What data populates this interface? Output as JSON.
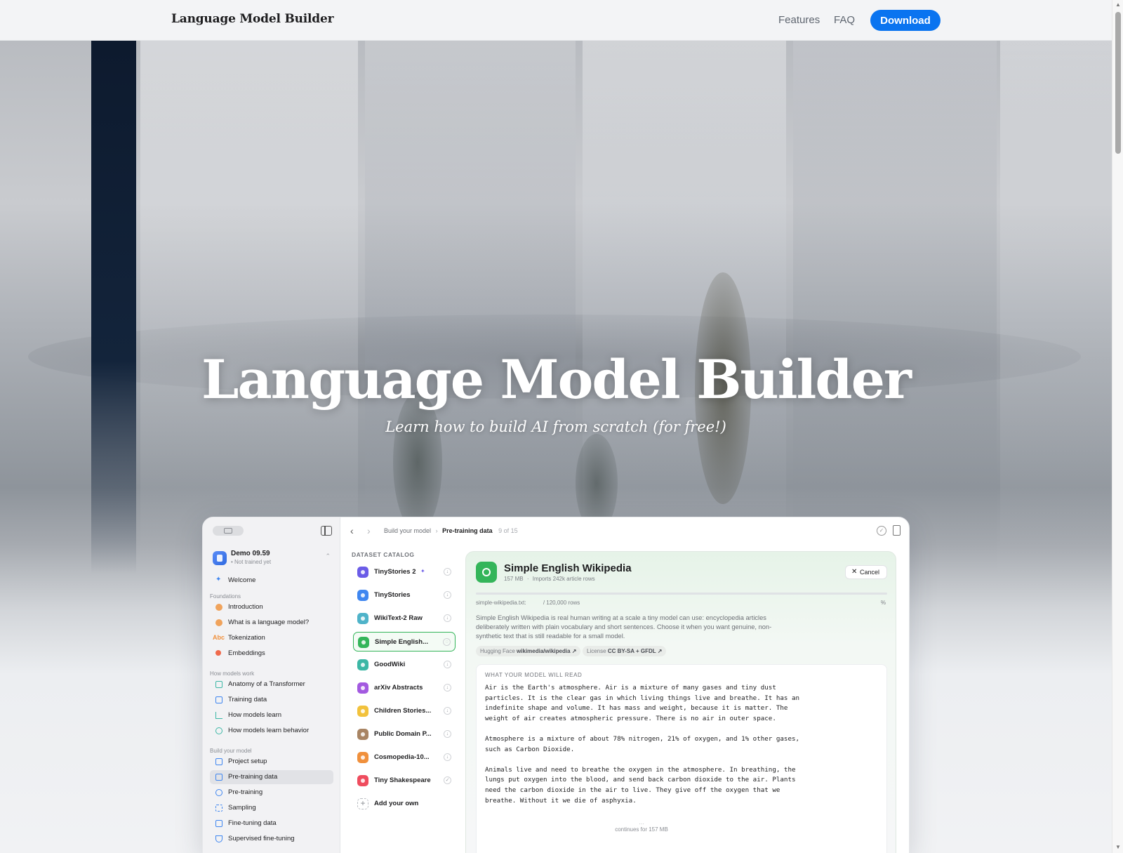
{
  "site": {
    "brand": "Language Model Builder",
    "nav": {
      "features": "Features",
      "faq": "FAQ",
      "download": "Download"
    }
  },
  "hero": {
    "title": "Language Model Builder",
    "subtitle": "Learn how to build AI from scratch (for free!)"
  },
  "app": {
    "project": {
      "name": "Demo 09.59",
      "status": "• Not trained yet"
    },
    "sidebar": {
      "top_item": "Welcome",
      "sections": [
        {
          "heading": "Foundations",
          "items": [
            "Introduction",
            "What is a language model?",
            "Tokenization",
            "Embeddings"
          ]
        },
        {
          "heading": "How models work",
          "items": [
            "Anatomy of a Transformer",
            "Training data",
            "How models learn",
            "How models learn behavior"
          ]
        },
        {
          "heading": "Build your model",
          "items": [
            "Project setup",
            "Pre-training data",
            "Pre-training",
            "Sampling",
            "Fine-tuning data",
            "Supervised fine-tuning"
          ]
        }
      ],
      "active_item": "Pre-training data",
      "abc_icon": "Abc"
    },
    "toolbar": {
      "breadcrumb_parent": "Build your model",
      "breadcrumb_sep": "›",
      "breadcrumb_current": "Pre-training data",
      "step": "9 of 15"
    },
    "catalog": {
      "heading": "DATASET CATALOG",
      "items": [
        {
          "label": "TinyStories 2",
          "color": "#6b5ce7",
          "badge": "✦",
          "icon": "moon-icon"
        },
        {
          "label": "TinyStories",
          "color": "#3f86f0",
          "icon": "book-icon"
        },
        {
          "label": "WikiText-2 Raw",
          "color": "#4fb3c9",
          "icon": "globe-icon"
        },
        {
          "label": "Simple English...",
          "color": "#34b55a",
          "icon": "globe-icon",
          "selected": true
        },
        {
          "label": "GoodWiki",
          "color": "#3cb7a5",
          "icon": "globe-icon"
        },
        {
          "label": "arXiv Abstracts",
          "color": "#a35ae0",
          "icon": "atom-icon"
        },
        {
          "label": "Children Stories...",
          "color": "#f2c23c",
          "icon": "storybook-icon"
        },
        {
          "label": "Public Domain P...",
          "color": "#a88463",
          "icon": "quote-icon"
        },
        {
          "label": "Cosmopedia-10...",
          "color": "#f0903c",
          "icon": "cap-icon"
        },
        {
          "label": "Tiny Shakespeare",
          "color": "#ef4c5e",
          "icon": "masks-icon",
          "checked": true
        }
      ],
      "add_label": "Add your own"
    },
    "detail": {
      "title": "Simple English Wikipedia",
      "size": "157 MB",
      "meta_sep": "·",
      "imports": "Imports 242k article rows",
      "cancel": "Cancel",
      "progress_pct": 0.0,
      "file": "simple-wikipedia.txt:",
      "rows": "/ 120,000 rows",
      "pct_label": "%",
      "description": "Simple English Wikipedia is real human writing at a scale a tiny model can use: encyclopedia articles deliberately written with plain vocabulary and short sentences. Choose it when you want genuine, non-synthetic text that is still readable for a small model.",
      "tags": [
        {
          "key": "Hugging Face",
          "value": "wikimedia/wikipedia ↗"
        },
        {
          "key": "License",
          "value": "CC BY-SA + GFDL ↗"
        }
      ],
      "preview_heading": "WHAT YOUR MODEL WILL READ",
      "preview_text": "Air is the Earth's atmosphere. Air is a mixture of many gases and tiny dust\nparticles. It is the clear gas in which living things live and breathe. It has an\nindefinite shape and volume. It has mass and weight, because it is matter. The\nweight of air creates atmospheric pressure. There is no air in outer space.\n\nAtmosphere is a mixture of about 78% nitrogen, 21% of oxygen, and 1% other gases,\nsuch as Carbon Dioxide.\n\nAnimals live and need to breathe the oxygen in the atmosphere. In breathing, the\nlungs put oxygen into the blood, and send back carbon dioxide to the air. Plants\nneed the carbon dioxide in the air to live. They give off the oxygen that we\nbreathe. Without it we die of asphyxia.",
      "continues": "continues for 157 MB"
    }
  }
}
